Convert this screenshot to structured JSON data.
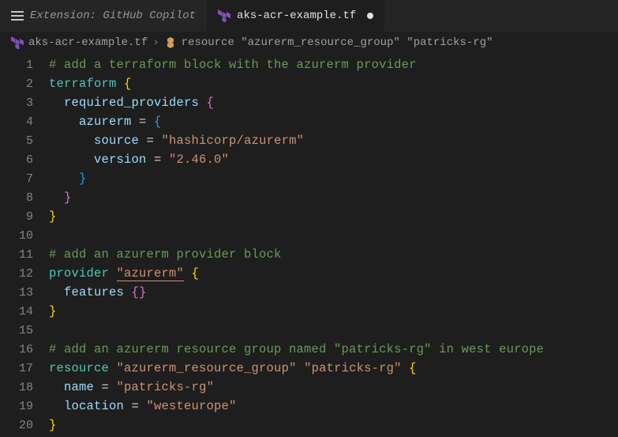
{
  "tabs": {
    "inactive": "Extension: GitHub Copilot",
    "active": "aks-acr-example.tf"
  },
  "breadcrumb": {
    "file": "aks-acr-example.tf",
    "symbol": "resource \"azurerm_resource_group\" \"patricks-rg\""
  },
  "lines": {
    "l1": "1",
    "l2": "2",
    "l3": "3",
    "l4": "4",
    "l5": "5",
    "l6": "6",
    "l7": "7",
    "l8": "8",
    "l9": "9",
    "l10": "10",
    "l11": "11",
    "l12": "12",
    "l13": "13",
    "l14": "14",
    "l15": "15",
    "l16": "16",
    "l17": "17",
    "l18": "18",
    "l19": "19",
    "l20": "20"
  },
  "code": {
    "c1": "# add a terraform block with the azurerm provider",
    "c2_kw": "terraform",
    "c3_prop": "required_providers",
    "c4_prop": "azurerm",
    "c4_eq": " = ",
    "c5_prop": "source",
    "c5_eq": " = ",
    "c5_str": "\"hashicorp/azurerm\"",
    "c6_prop": "version",
    "c6_eq": " = ",
    "c6_str": "\"2.46.0\"",
    "c11": "# add an azurerm provider block",
    "c12_kw": "provider",
    "c12_str": "\"azurerm\"",
    "c13_prop": "features",
    "c16": "# add an azurerm resource group named \"patricks-rg\" in west europe",
    "c17_kw": "resource",
    "c17_s1": "\"azurerm_resource_group\"",
    "c17_s2": "\"patricks-rg\"",
    "c18_prop": "name",
    "c18_eq": " = ",
    "c18_str": "\"patricks-rg\"",
    "c19_prop": "location",
    "c19_eq": " = ",
    "c19_str": "\"westeurope\""
  }
}
